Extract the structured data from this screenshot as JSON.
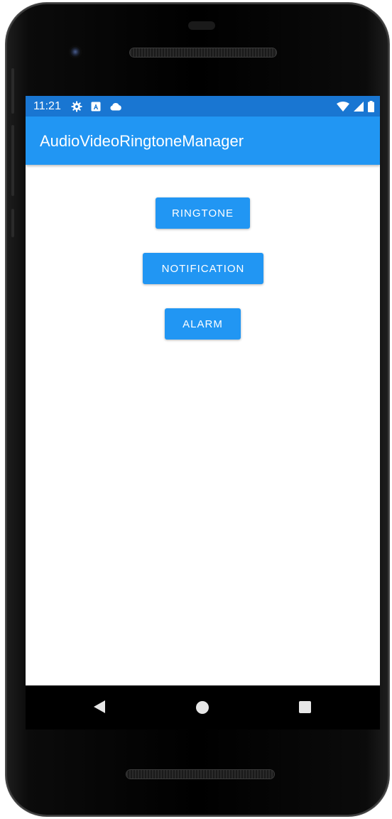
{
  "status_bar": {
    "time": "11:21",
    "left_icons": [
      "gear-icon",
      "a-badge-icon",
      "cloud-icon"
    ],
    "right_icons": [
      "wifi-icon",
      "cell-signal-icon",
      "battery-icon"
    ],
    "color": "#1976d2"
  },
  "app_bar": {
    "title": "AudioVideoRingtoneManager",
    "color": "#2196f3"
  },
  "buttons": {
    "ringtone": "RINGTONE",
    "notification": "NOTIFICATION",
    "alarm": "ALARM",
    "color": "#2196f3"
  },
  "nav_bar": {
    "icons": [
      "back-icon",
      "home-icon",
      "recents-icon"
    ]
  }
}
